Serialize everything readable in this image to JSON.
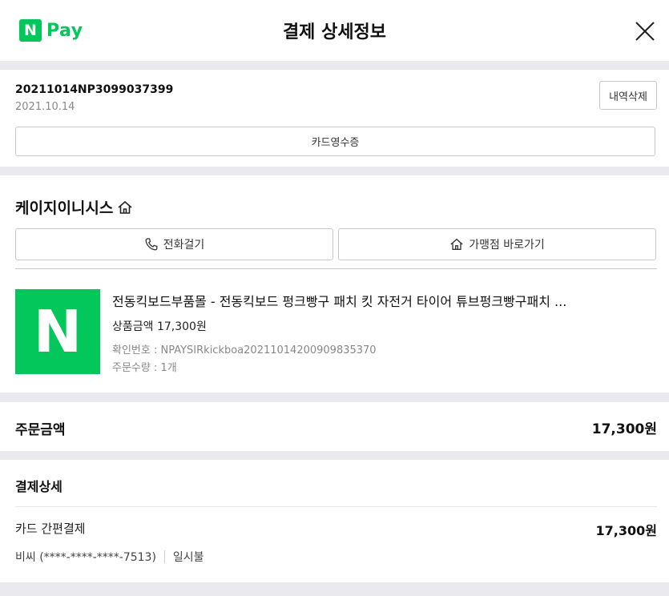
{
  "header": {
    "logo_letter": "N",
    "logo_text": "Pay",
    "title": "결제 상세정보",
    "brand_color": "#03c75a"
  },
  "order": {
    "number": "20211014NP3099037399",
    "date": "2021.10.14",
    "delete_label": "내역삭제",
    "receipt_label": "카드영수증"
  },
  "merchant": {
    "name": "케이지이니시스",
    "call_label": "전화걸기",
    "shop_label": "가맹점 바로가기"
  },
  "product": {
    "thumb_letter": "N",
    "name": "전동킥보드부품몰 - 전동킥보드 펑크빵구 패치 킷 자전거 타이어 튜브펑크빵구패치 ...",
    "price": "상품금액 17,300원",
    "confirm_no": "확인번호 : NPAYSIRkickboa20211014200909835370",
    "quantity": "주문수량 : 1개"
  },
  "total": {
    "label": "주문금액",
    "value": "17,300원"
  },
  "payment_detail": {
    "title": "결제상세",
    "method": "카드 간편결제",
    "amount": "17,300원",
    "card": "비씨 (****-****-****-7513)",
    "installment": "일시불"
  }
}
